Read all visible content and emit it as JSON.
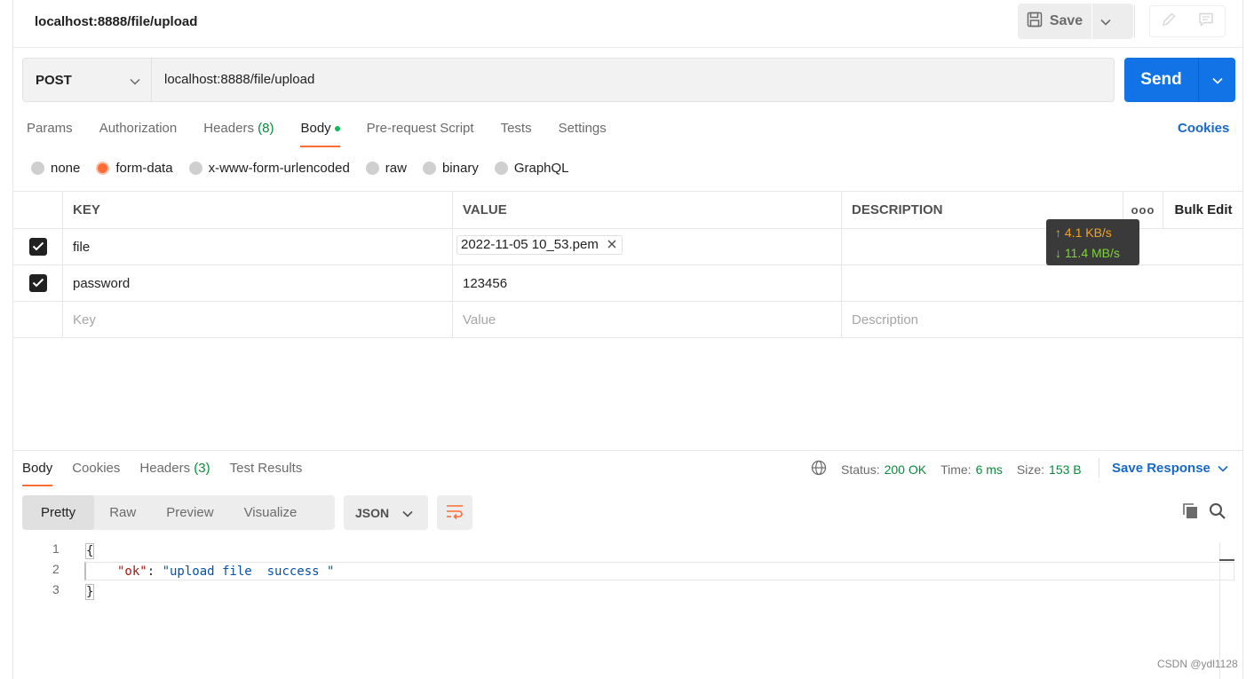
{
  "header": {
    "title": "localhost:8888/file/upload",
    "save_label": "Save"
  },
  "request": {
    "method": "POST",
    "url": "localhost:8888/file/upload",
    "send_label": "Send"
  },
  "request_tabs": {
    "params": "Params",
    "authorization": "Authorization",
    "headers": "Headers",
    "headers_count": "(8)",
    "body": "Body",
    "prerequest": "Pre-request Script",
    "tests": "Tests",
    "settings": "Settings",
    "active": "Body"
  },
  "cookies_link": "Cookies",
  "body_types": {
    "none": "none",
    "form_data": "form-data",
    "urlencoded": "x-www-form-urlencoded",
    "raw": "raw",
    "binary": "binary",
    "graphql": "GraphQL",
    "selected": "form-data"
  },
  "params_table": {
    "headers": {
      "key": "KEY",
      "value": "VALUE",
      "description": "DESCRIPTION",
      "more": "ooo",
      "bulk_edit": "Bulk Edit"
    },
    "rows": [
      {
        "checked": true,
        "key": "file",
        "value": "2022-11-05 10_53.pem",
        "is_file": true,
        "description": ""
      },
      {
        "checked": true,
        "key": "password",
        "value": "123456",
        "description": ""
      }
    ],
    "placeholders": {
      "key": "Key",
      "value": "Value",
      "description": "Description"
    }
  },
  "network_speed": {
    "upload": "↑ 4.1 KB/s",
    "download": "↓ 11.4 MB/s"
  },
  "response": {
    "tabs": {
      "body": "Body",
      "cookies": "Cookies",
      "headers": "Headers",
      "headers_count": "(3)",
      "test_results": "Test Results"
    },
    "status_label": "Status:",
    "status_value": "200 OK",
    "time_label": "Time:",
    "time_value": "6 ms",
    "size_label": "Size:",
    "size_value": "153 B",
    "save_response": "Save Response",
    "view_modes": {
      "pretty": "Pretty",
      "raw": "Raw",
      "preview": "Preview",
      "visualize": "Visualize",
      "active": "Pretty"
    },
    "format": "JSON",
    "code": {
      "line_numbers": [
        "1",
        "2",
        "3"
      ],
      "open_brace": "{",
      "key": "\"ok\"",
      "colon": ": ",
      "value": "\"upload file  success \"",
      "close_brace": "}"
    }
  },
  "watermark": "CSDN @ydl1128",
  "colors": {
    "accent": "#ff6c37",
    "send_blue": "#1273e6",
    "link_blue": "#1768c9",
    "success_green": "#0c8a3d"
  }
}
